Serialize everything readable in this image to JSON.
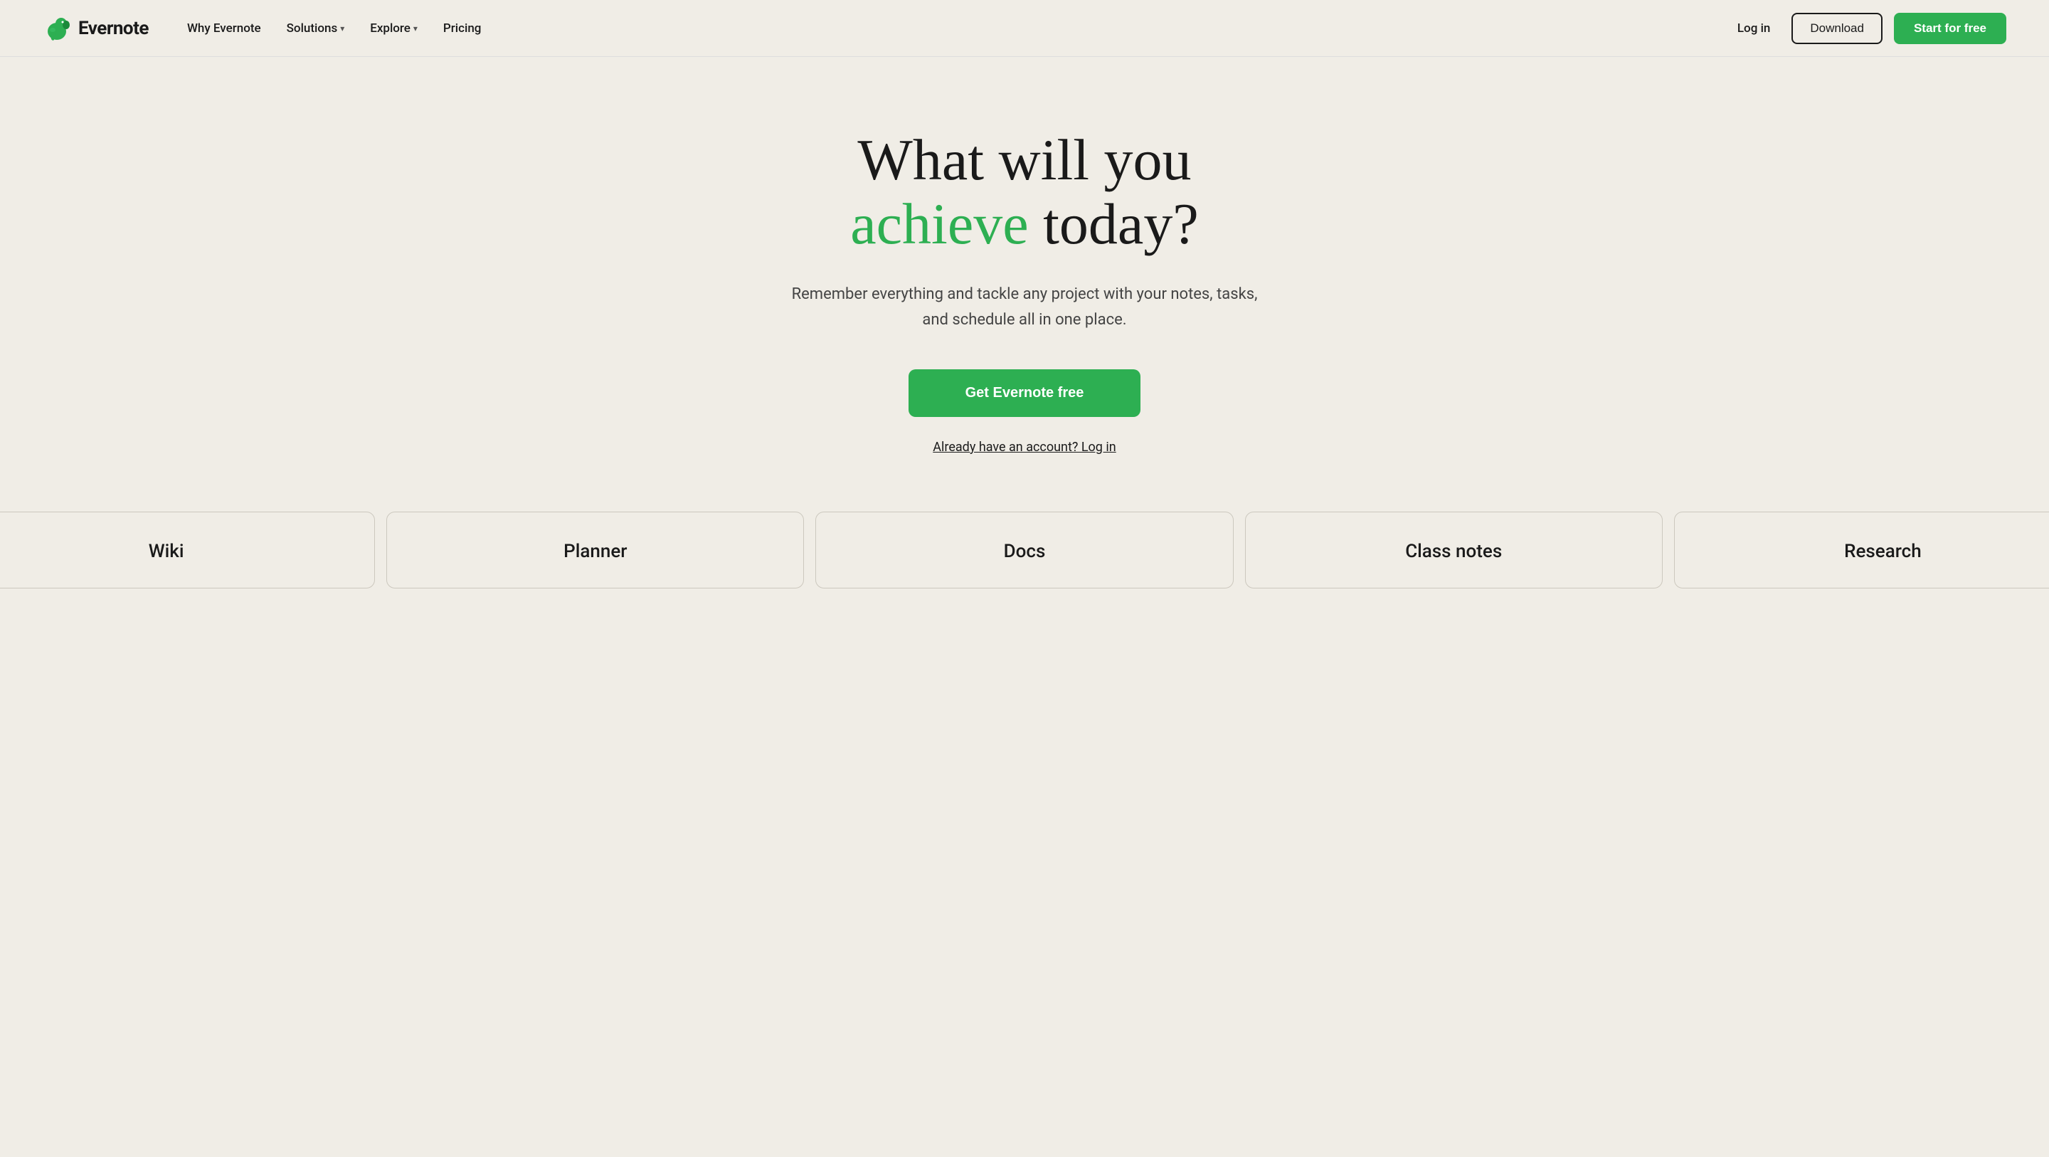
{
  "header": {
    "logo_text": "Evernote",
    "nav_items": [
      {
        "label": "Why Evernote",
        "has_dropdown": false
      },
      {
        "label": "Solutions",
        "has_dropdown": true
      },
      {
        "label": "Explore",
        "has_dropdown": true
      },
      {
        "label": "Pricing",
        "has_dropdown": false
      }
    ],
    "login_label": "Log in",
    "download_label": "Download",
    "start_label": "Start for free"
  },
  "hero": {
    "title_line1": "What will you",
    "title_line2_green": "achieve",
    "title_line2_black": " today?",
    "subtitle": "Remember everything and tackle any project with your notes, tasks, and schedule all in one place.",
    "cta_label": "Get Evernote free",
    "login_link_label": "Already have an account? Log in"
  },
  "cards": [
    {
      "label": "Wiki"
    },
    {
      "label": "Planner"
    },
    {
      "label": "Docs"
    },
    {
      "label": "Class notes"
    },
    {
      "label": "Research"
    }
  ],
  "colors": {
    "green": "#2daf52",
    "background": "#f0ede6",
    "text_dark": "#1a1a1a",
    "text_mid": "#444444",
    "border": "#ccc8be"
  }
}
